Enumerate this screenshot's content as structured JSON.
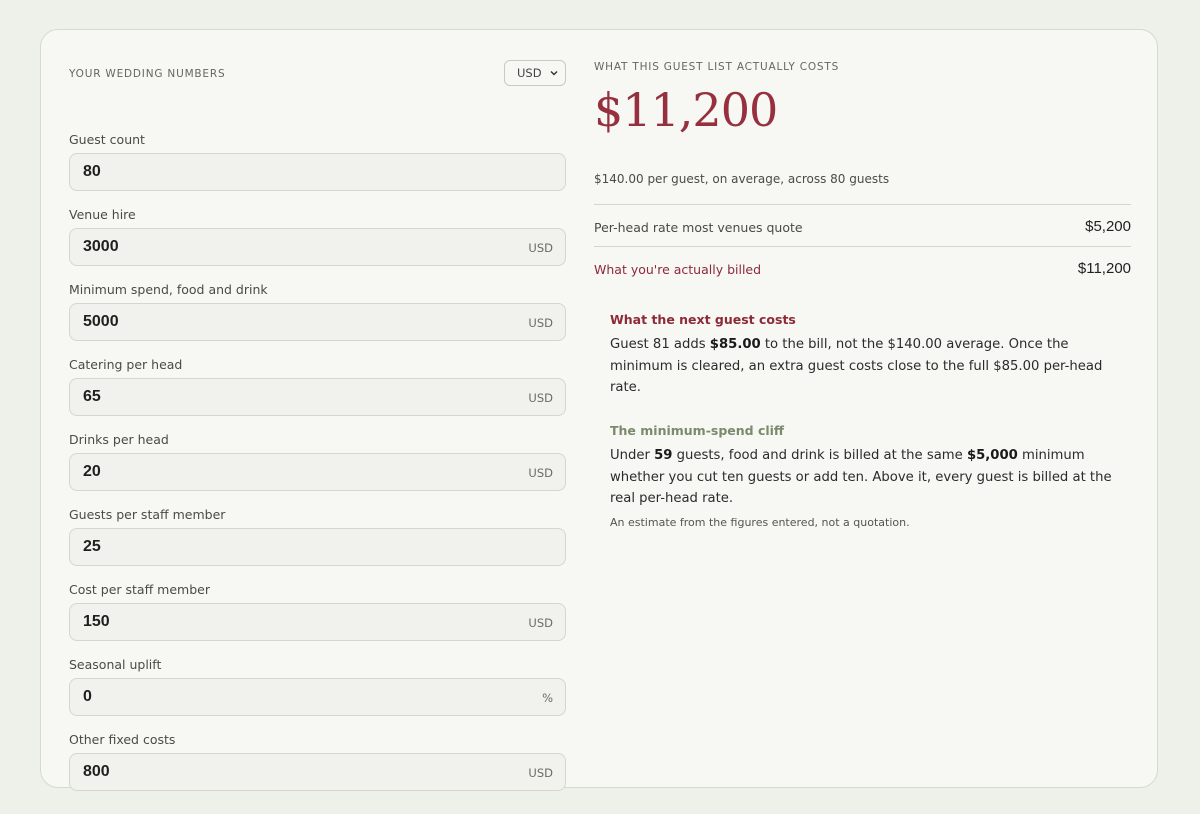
{
  "form": {
    "title": "YOUR WEDDING NUMBERS",
    "currency": "USD",
    "fields": [
      {
        "label": "Guest count",
        "value": "80",
        "unit": ""
      },
      {
        "label": "Venue hire",
        "value": "3000",
        "unit": "USD"
      },
      {
        "label": "Minimum spend, food and drink",
        "value": "5000",
        "unit": "USD"
      },
      {
        "label": "Catering per head",
        "value": "65",
        "unit": "USD"
      },
      {
        "label": "Drinks per head",
        "value": "20",
        "unit": "USD"
      },
      {
        "label": "Guests per staff member",
        "value": "25",
        "unit": ""
      },
      {
        "label": "Cost per staff member",
        "value": "150",
        "unit": "USD"
      },
      {
        "label": "Seasonal uplift",
        "value": "0",
        "unit": "%"
      },
      {
        "label": "Other fixed costs",
        "value": "800",
        "unit": "USD"
      }
    ]
  },
  "summary": {
    "title": "WHAT THIS GUEST LIST ACTUALLY COSTS",
    "total": "$11,200",
    "subline": "$140.00 per guest, on average, across 80 guests",
    "rows": [
      {
        "label": "Per-head rate most venues quote",
        "value": "$5,200"
      },
      {
        "label": "What you're actually billed",
        "value": "$11,200"
      }
    ]
  },
  "next_guest": {
    "title": "What the next guest costs",
    "pre": "Guest 81 adds ",
    "amount": "$85.00",
    "post": " to the bill, not the $140.00 average. Once the minimum is cleared, an extra guest costs close to the full $85.00 per-head rate."
  },
  "cliff": {
    "title": "The minimum-spend cliff",
    "pre": "Under ",
    "guests": "59",
    "mid": " guests, food and drink is billed at the same ",
    "minimum": "$5,000",
    "post": " minimum whether you cut ten guests or add ten. Above it, every guest is billed at the real per-head rate.",
    "footnote": "An estimate from the figures entered, not a quotation."
  },
  "colors": {
    "accent": "#96303f",
    "green_title": "#7a8a6a",
    "background": "#eef0ea",
    "card": "#f7f7f4"
  }
}
